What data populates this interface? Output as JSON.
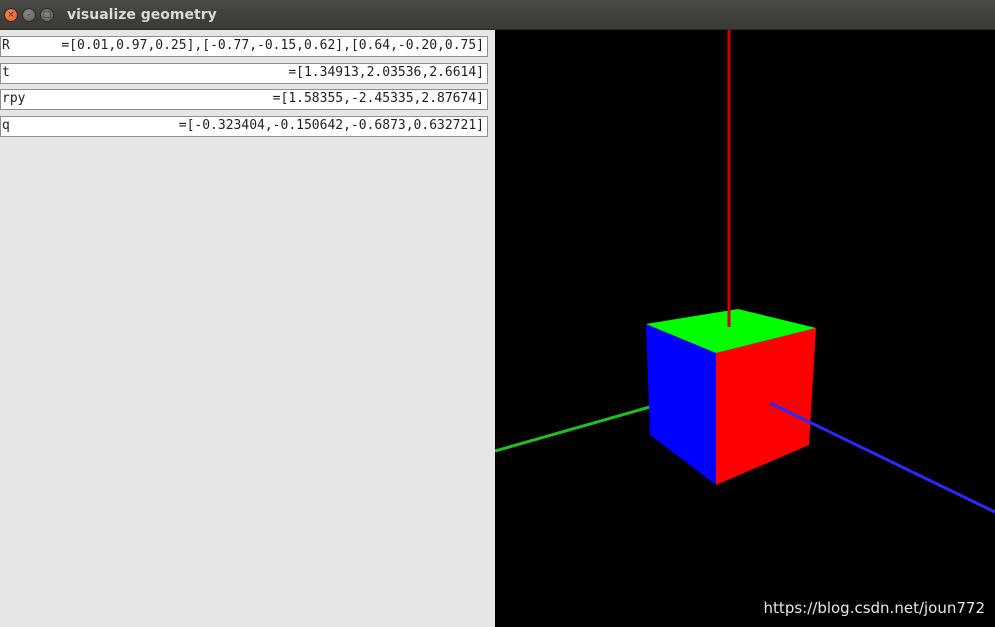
{
  "window": {
    "title": "visualize geometry",
    "buttons": {
      "close": "×",
      "minimize": "–",
      "maximize": "□"
    }
  },
  "fields": [
    {
      "label": "R",
      "value": "=[0.01,0.97,0.25],[-0.77,-0.15,0.62],[0.64,-0.20,0.75]"
    },
    {
      "label": "t",
      "value": "=[1.34913,2.03536,2.6614]"
    },
    {
      "label": "rpy",
      "value": "=[1.58355,-2.45335,2.87674]"
    },
    {
      "label": "q",
      "value": "=[-0.323404,-0.150642,-0.6873,0.632721]"
    }
  ],
  "viewport": {
    "background": "#000000",
    "cube_faces": {
      "top": "#00ff00",
      "left": "#0000ff",
      "right": "#ff0000"
    },
    "axis_colors": {
      "x": "#2828ff",
      "y": "#1fbf1f",
      "z": "#d00000"
    },
    "watermark": "https://blog.csdn.net/joun772"
  }
}
